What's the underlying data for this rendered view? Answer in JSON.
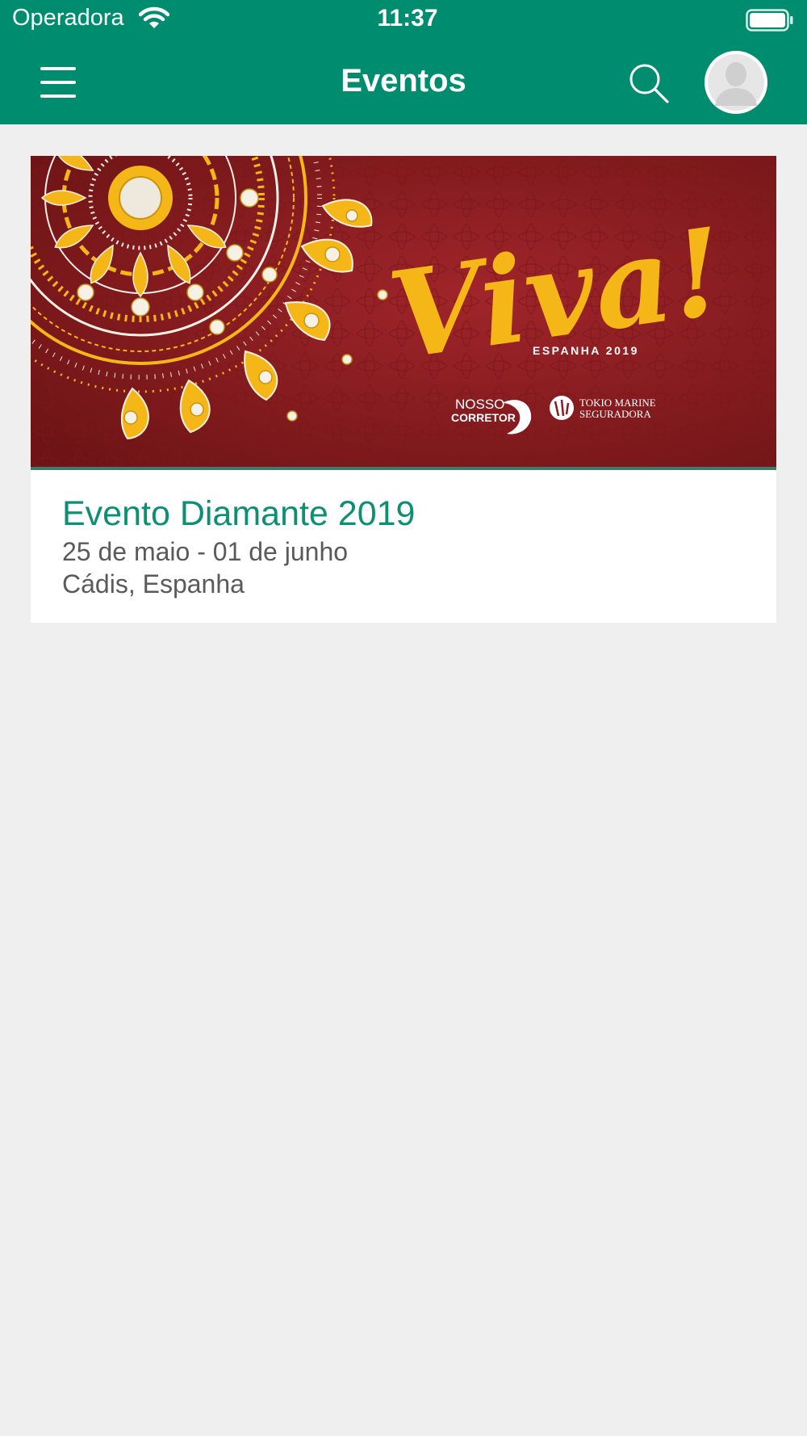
{
  "status_bar": {
    "carrier": "Operadora",
    "time": "11:37",
    "wifi_icon": "wifi-icon",
    "battery_icon": "battery-icon"
  },
  "header": {
    "title": "Eventos",
    "menu_icon": "hamburger-menu-icon",
    "search_icon": "search-icon",
    "avatar_icon": "user-avatar-icon"
  },
  "events": [
    {
      "banner": {
        "script_text": "Viva!",
        "subtitle": "ESPANHA 2019",
        "logo_1_line_1": "NOSSO",
        "logo_1_line_2": "CORRETOR",
        "logo_2_line_1": "TOKIO MARINE",
        "logo_2_line_2": "SEGURADORA"
      },
      "title": "Evento Diamante 2019",
      "dates": "25 de maio - 01 de junho",
      "location": "Cádis, Espanha"
    }
  ],
  "colors": {
    "app_bar": "#008c6e",
    "background": "#efefef",
    "accent_text": "#0c8f73",
    "banner_red": "#8a1c1e",
    "banner_gold": "#f5b617"
  }
}
